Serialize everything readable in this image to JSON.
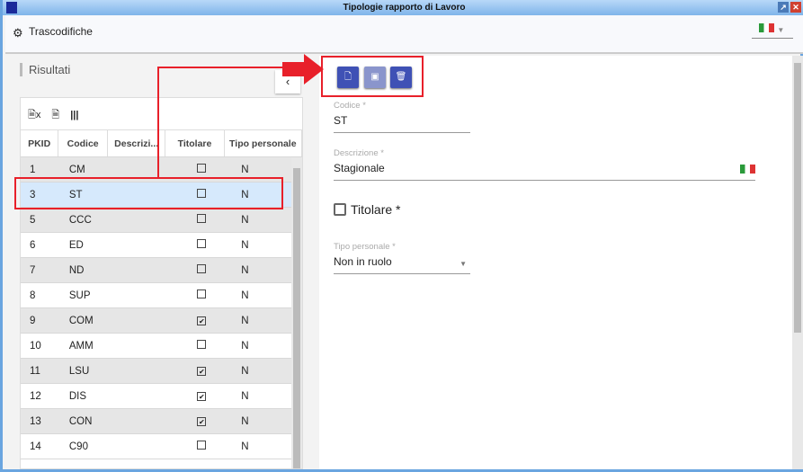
{
  "window": {
    "title": "Tipologie rapporto di Lavoro"
  },
  "header": {
    "title": "Trascodifiche",
    "icon": "gear-icon",
    "language": "it"
  },
  "results": {
    "title": "Risultati",
    "collapse": "‹",
    "tools": [
      "excel-icon",
      "pdf-icon",
      "columns-icon"
    ],
    "columns": [
      "PKID",
      "Codice",
      "Descrizi...",
      "Titolare",
      "Tipo personale"
    ],
    "rows": [
      {
        "pkid": "1",
        "codice": "CM",
        "titolare": false,
        "tipo": "N"
      },
      {
        "pkid": "3",
        "codice": "ST",
        "titolare": false,
        "tipo": "N",
        "selected": true
      },
      {
        "pkid": "5",
        "codice": "CCC",
        "titolare": false,
        "tipo": "N"
      },
      {
        "pkid": "6",
        "codice": "ED",
        "titolare": false,
        "tipo": "N"
      },
      {
        "pkid": "7",
        "codice": "ND",
        "titolare": false,
        "tipo": "N"
      },
      {
        "pkid": "8",
        "codice": "SUP",
        "titolare": false,
        "tipo": "N"
      },
      {
        "pkid": "9",
        "codice": "COM",
        "titolare": true,
        "tipo": "N"
      },
      {
        "pkid": "10",
        "codice": "AMM",
        "titolare": false,
        "tipo": "N"
      },
      {
        "pkid": "11",
        "codice": "LSU",
        "titolare": true,
        "tipo": "N"
      },
      {
        "pkid": "12",
        "codice": "DIS",
        "titolare": true,
        "tipo": "N"
      },
      {
        "pkid": "13",
        "codice": "CON",
        "titolare": true,
        "tipo": "N"
      },
      {
        "pkid": "14",
        "codice": "C90",
        "titolare": false,
        "tipo": "N"
      }
    ]
  },
  "form": {
    "codice": {
      "label": "Codice *",
      "value": "ST"
    },
    "descrizione": {
      "label": "Descrizione *",
      "value": "Stagionale"
    },
    "titolare": {
      "label": "Titolare *",
      "checked": false
    },
    "tipo": {
      "label": "Tipo personale *",
      "value": "Non in ruolo"
    }
  },
  "colors": {
    "accent": "#3f51b5",
    "annotation": "#e8202a",
    "selected_row": "#d6e9fc"
  }
}
